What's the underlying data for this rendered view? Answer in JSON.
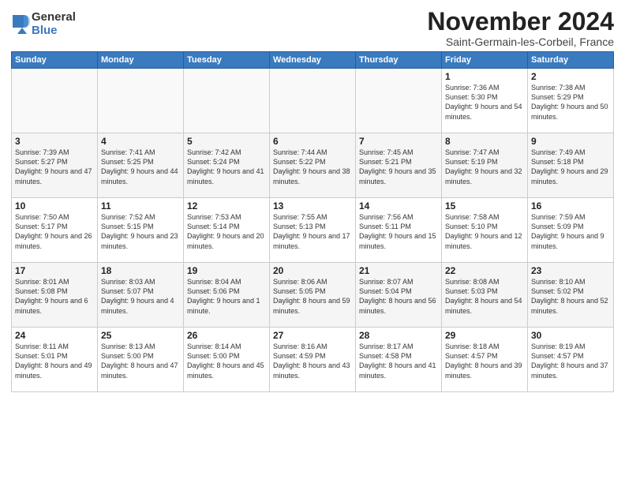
{
  "logo": {
    "general": "General",
    "blue": "Blue"
  },
  "title": "November 2024",
  "location": "Saint-Germain-les-Corbeil, France",
  "weekdays": [
    "Sunday",
    "Monday",
    "Tuesday",
    "Wednesday",
    "Thursday",
    "Friday",
    "Saturday"
  ],
  "weeks": [
    [
      {
        "day": "",
        "info": ""
      },
      {
        "day": "",
        "info": ""
      },
      {
        "day": "",
        "info": ""
      },
      {
        "day": "",
        "info": ""
      },
      {
        "day": "",
        "info": ""
      },
      {
        "day": "1",
        "info": "Sunrise: 7:36 AM\nSunset: 5:30 PM\nDaylight: 9 hours and 54 minutes."
      },
      {
        "day": "2",
        "info": "Sunrise: 7:38 AM\nSunset: 5:29 PM\nDaylight: 9 hours and 50 minutes."
      }
    ],
    [
      {
        "day": "3",
        "info": "Sunrise: 7:39 AM\nSunset: 5:27 PM\nDaylight: 9 hours and 47 minutes."
      },
      {
        "day": "4",
        "info": "Sunrise: 7:41 AM\nSunset: 5:25 PM\nDaylight: 9 hours and 44 minutes."
      },
      {
        "day": "5",
        "info": "Sunrise: 7:42 AM\nSunset: 5:24 PM\nDaylight: 9 hours and 41 minutes."
      },
      {
        "day": "6",
        "info": "Sunrise: 7:44 AM\nSunset: 5:22 PM\nDaylight: 9 hours and 38 minutes."
      },
      {
        "day": "7",
        "info": "Sunrise: 7:45 AM\nSunset: 5:21 PM\nDaylight: 9 hours and 35 minutes."
      },
      {
        "day": "8",
        "info": "Sunrise: 7:47 AM\nSunset: 5:19 PM\nDaylight: 9 hours and 32 minutes."
      },
      {
        "day": "9",
        "info": "Sunrise: 7:49 AM\nSunset: 5:18 PM\nDaylight: 9 hours and 29 minutes."
      }
    ],
    [
      {
        "day": "10",
        "info": "Sunrise: 7:50 AM\nSunset: 5:17 PM\nDaylight: 9 hours and 26 minutes."
      },
      {
        "day": "11",
        "info": "Sunrise: 7:52 AM\nSunset: 5:15 PM\nDaylight: 9 hours and 23 minutes."
      },
      {
        "day": "12",
        "info": "Sunrise: 7:53 AM\nSunset: 5:14 PM\nDaylight: 9 hours and 20 minutes."
      },
      {
        "day": "13",
        "info": "Sunrise: 7:55 AM\nSunset: 5:13 PM\nDaylight: 9 hours and 17 minutes."
      },
      {
        "day": "14",
        "info": "Sunrise: 7:56 AM\nSunset: 5:11 PM\nDaylight: 9 hours and 15 minutes."
      },
      {
        "day": "15",
        "info": "Sunrise: 7:58 AM\nSunset: 5:10 PM\nDaylight: 9 hours and 12 minutes."
      },
      {
        "day": "16",
        "info": "Sunrise: 7:59 AM\nSunset: 5:09 PM\nDaylight: 9 hours and 9 minutes."
      }
    ],
    [
      {
        "day": "17",
        "info": "Sunrise: 8:01 AM\nSunset: 5:08 PM\nDaylight: 9 hours and 6 minutes."
      },
      {
        "day": "18",
        "info": "Sunrise: 8:03 AM\nSunset: 5:07 PM\nDaylight: 9 hours and 4 minutes."
      },
      {
        "day": "19",
        "info": "Sunrise: 8:04 AM\nSunset: 5:06 PM\nDaylight: 9 hours and 1 minute."
      },
      {
        "day": "20",
        "info": "Sunrise: 8:06 AM\nSunset: 5:05 PM\nDaylight: 8 hours and 59 minutes."
      },
      {
        "day": "21",
        "info": "Sunrise: 8:07 AM\nSunset: 5:04 PM\nDaylight: 8 hours and 56 minutes."
      },
      {
        "day": "22",
        "info": "Sunrise: 8:08 AM\nSunset: 5:03 PM\nDaylight: 8 hours and 54 minutes."
      },
      {
        "day": "23",
        "info": "Sunrise: 8:10 AM\nSunset: 5:02 PM\nDaylight: 8 hours and 52 minutes."
      }
    ],
    [
      {
        "day": "24",
        "info": "Sunrise: 8:11 AM\nSunset: 5:01 PM\nDaylight: 8 hours and 49 minutes."
      },
      {
        "day": "25",
        "info": "Sunrise: 8:13 AM\nSunset: 5:00 PM\nDaylight: 8 hours and 47 minutes."
      },
      {
        "day": "26",
        "info": "Sunrise: 8:14 AM\nSunset: 5:00 PM\nDaylight: 8 hours and 45 minutes."
      },
      {
        "day": "27",
        "info": "Sunrise: 8:16 AM\nSunset: 4:59 PM\nDaylight: 8 hours and 43 minutes."
      },
      {
        "day": "28",
        "info": "Sunrise: 8:17 AM\nSunset: 4:58 PM\nDaylight: 8 hours and 41 minutes."
      },
      {
        "day": "29",
        "info": "Sunrise: 8:18 AM\nSunset: 4:57 PM\nDaylight: 8 hours and 39 minutes."
      },
      {
        "day": "30",
        "info": "Sunrise: 8:19 AM\nSunset: 4:57 PM\nDaylight: 8 hours and 37 minutes."
      }
    ]
  ]
}
